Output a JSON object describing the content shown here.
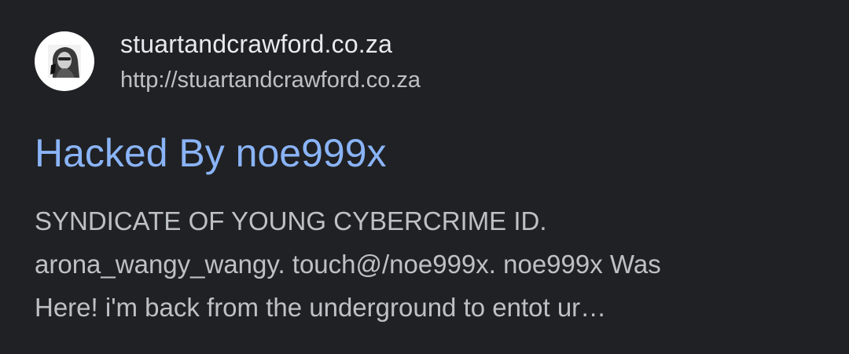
{
  "result": {
    "favicon": {
      "icon": "avatar-photo-icon"
    },
    "site_name": "stuartandcrawford.co.za",
    "site_url": "http://stuartandcrawford.co.za",
    "title": "Hacked By noe999x",
    "snippet_lines": [
      "SYNDICATE OF YOUNG CYBERCRIME ID.",
      "arona_wangy_wangy. touch@/noe999x. noe999x Was",
      "Here! i'm back from the underground to entot ur…"
    ]
  },
  "colors": {
    "background": "#202124",
    "title_link": "#8ab4f8",
    "site_name": "#e8eaed",
    "secondary_text": "#bdc1c6",
    "favicon_bg": "#ffffff"
  }
}
